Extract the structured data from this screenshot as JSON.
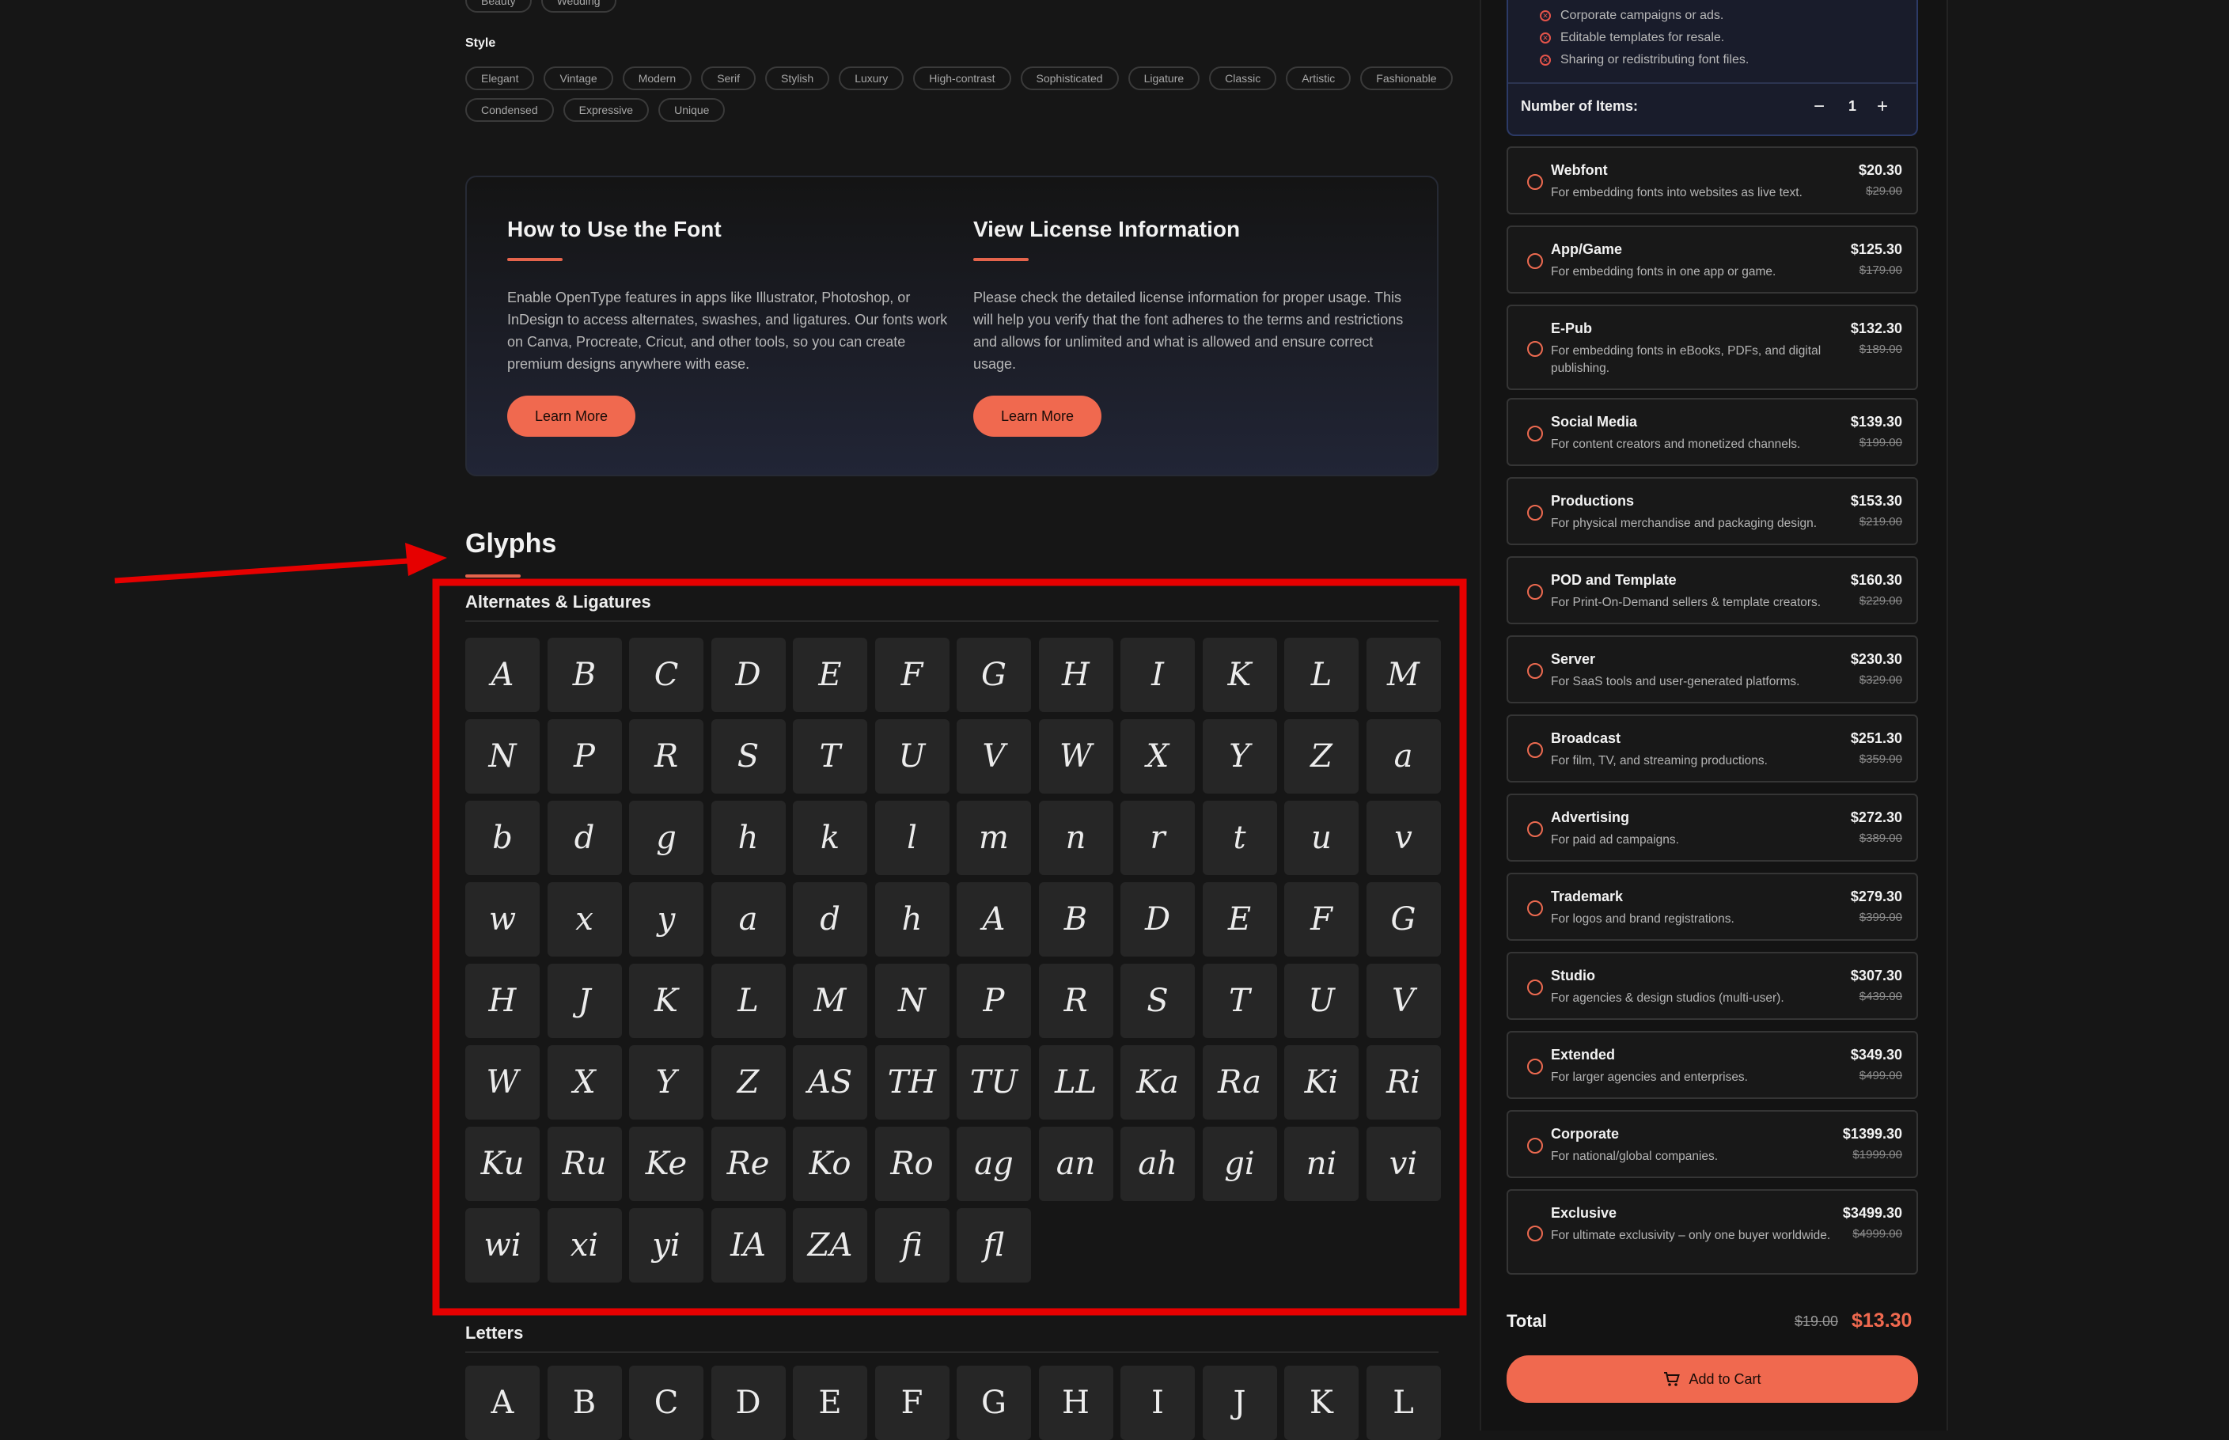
{
  "tags_top": [
    "Beauty",
    "Wedding"
  ],
  "style": {
    "label": "Style",
    "row1": [
      "Elegant",
      "Vintage",
      "Modern",
      "Serif",
      "Stylish",
      "Luxury",
      "High-contrast",
      "Sophisticated",
      "Ligature",
      "Classic",
      "Artistic",
      "Fashionable"
    ],
    "row2": [
      "Condensed",
      "Expressive",
      "Unique"
    ]
  },
  "how_to_use": {
    "title": "How to Use the Font",
    "body": "Enable OpenType features in apps like Illustrator, Photoshop, or InDesign to access alternates, swashes, and ligatures. Our fonts work on Canva, Procreate, Cricut, and other tools, so you can create premium designs anywhere with ease.",
    "button": "Learn More"
  },
  "license_info": {
    "title": "View License Information",
    "body": "Please check the detailed license information for proper usage. This will help you verify that the font adheres to the terms and restrictions and allows for unlimited and what is allowed and ensure correct usage.",
    "button": "Learn More"
  },
  "glyphs": {
    "title": "Glyphs",
    "alternates_label": "Alternates & Ligatures",
    "alternates": [
      "A",
      "B",
      "C",
      "D",
      "E",
      "F",
      "G",
      "H",
      "I",
      "K",
      "L",
      "M",
      "N",
      "P",
      "R",
      "S",
      "T",
      "U",
      "V",
      "W",
      "X",
      "Y",
      "Z",
      "a",
      "b",
      "d",
      "g",
      "h",
      "k",
      "l",
      "m",
      "n",
      "r",
      "t",
      "u",
      "v",
      "w",
      "x",
      "y",
      "a",
      "d",
      "h",
      "A",
      "B",
      "D",
      "E",
      "F",
      "G",
      "H",
      "J",
      "K",
      "L",
      "M",
      "N",
      "P",
      "R",
      "S",
      "T",
      "U",
      "V",
      "W",
      "X",
      "Y",
      "Z",
      "AS",
      "TH",
      "TU",
      "LL",
      "Ka",
      "Ra",
      "Ki",
      "Ri",
      "Ku",
      "Ru",
      "Ke",
      "Re",
      "Ko",
      "Ro",
      "ag",
      "an",
      "ah",
      "gi",
      "ni",
      "vi",
      "wi",
      "xi",
      "yi",
      "IA",
      "ZA",
      "fi",
      "fl"
    ],
    "letters_label": "Letters",
    "letters": [
      "A",
      "B",
      "C",
      "D",
      "E",
      "F",
      "G",
      "H",
      "I",
      "J",
      "K",
      "L"
    ]
  },
  "sidebar": {
    "exclusions": [
      "Corporate campaigns or ads.",
      "Editable templates for resale.",
      "Sharing or redistributing font files."
    ],
    "number_of_items_label": "Number of Items:",
    "quantity": "1",
    "minus": "−",
    "plus": "+",
    "options": [
      {
        "title": "Webfont",
        "desc": "For embedding fonts into websites as live text.",
        "price": "$20.30",
        "old": "$29.00"
      },
      {
        "title": "App/Game",
        "desc": "For embedding fonts in one app or game.",
        "price": "$125.30",
        "old": "$179.00"
      },
      {
        "title": "E-Pub",
        "desc": "For embedding fonts in eBooks, PDFs, and digital publishing.",
        "price": "$132.30",
        "old": "$189.00"
      },
      {
        "title": "Social Media",
        "desc": "For content creators and monetized channels.",
        "price": "$139.30",
        "old": "$199.00"
      },
      {
        "title": "Productions",
        "desc": "For physical merchandise and packaging design.",
        "price": "$153.30",
        "old": "$219.00"
      },
      {
        "title": "POD and Template",
        "desc": "For Print-On-Demand sellers & template creators.",
        "price": "$160.30",
        "old": "$229.00"
      },
      {
        "title": "Server",
        "desc": "For SaaS tools and user-generated platforms.",
        "price": "$230.30",
        "old": "$329.00"
      },
      {
        "title": "Broadcast",
        "desc": "For film, TV, and streaming productions.",
        "price": "$251.30",
        "old": "$359.00"
      },
      {
        "title": "Advertising",
        "desc": "For paid ad campaigns.",
        "price": "$272.30",
        "old": "$389.00"
      },
      {
        "title": "Trademark",
        "desc": "For logos and brand registrations.",
        "price": "$279.30",
        "old": "$399.00"
      },
      {
        "title": "Studio",
        "desc": "For agencies & design studios (multi-user).",
        "price": "$307.30",
        "old": "$439.00"
      },
      {
        "title": "Extended",
        "desc": "For larger agencies and enterprises.",
        "price": "$349.30",
        "old": "$499.00"
      },
      {
        "title": "Corporate",
        "desc": "For national/global companies.",
        "price": "$1399.30",
        "old": "$1999.00"
      },
      {
        "title": "Exclusive",
        "desc": "For ultimate exclusivity – only one buyer worldwide.",
        "price": "$3499.30",
        "old": "$4999.00"
      }
    ],
    "total_label": "Total",
    "total_old": "$19.00",
    "total_price": "$13.30",
    "add_to_cart": "Add to Cart"
  },
  "colors": {
    "accent": "#f0694f",
    "annotation": "#e60000",
    "background": "#161616"
  }
}
